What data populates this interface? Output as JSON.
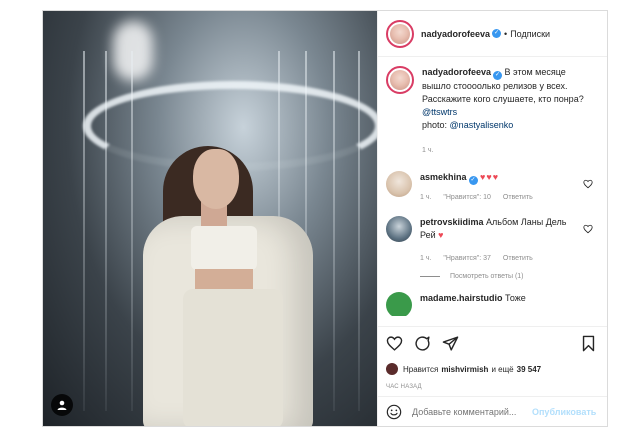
{
  "post": {
    "author": "nadyadorofeeva",
    "follow_separator": "•",
    "follow_label": "Подписки",
    "caption": {
      "author": "nadyadorofeeva",
      "text_line1": "В этом месяце вышло стооoолько релизов у всех. Расскажите кого слушаете, кто понра?",
      "mention1": "@ttswtrs",
      "photo_label": "photo:",
      "mention2": "@nastyalisenko",
      "time": "1 ч."
    },
    "comments": [
      {
        "author": "asmekhina",
        "text": "",
        "hearts": "♥♥♥",
        "time": "1 ч.",
        "likes": "\"Нравится\": 10",
        "reply": "Ответить"
      },
      {
        "author": "petrovskiidima",
        "text": "Альбом Ланы Дель Рей",
        "hearts": "♥",
        "time": "1 ч.",
        "likes": "\"Нравится\": 37",
        "reply": "Ответить",
        "view_replies": "Посмотреть ответы (1)"
      },
      {
        "author": "madame.hairstudio",
        "text": "Тоже"
      }
    ],
    "likes": {
      "prefix": "Нравится",
      "user": "mishvirmish",
      "middle": "и ещё",
      "count": "39 547"
    },
    "time_ago": "ЧАС НАЗАД",
    "add_comment_placeholder": "Добавьте комментарий...",
    "publish_label": "Опубликовать"
  },
  "colors": {
    "verified": "#3897f0",
    "heart": "#ed4956",
    "publish_disabled": "#b2dffc",
    "link": "#00376b"
  },
  "icons": [
    "user-tag-icon",
    "verified-icon",
    "heart-icon",
    "comment-icon",
    "share-icon",
    "bookmark-icon",
    "emoji-icon"
  ]
}
